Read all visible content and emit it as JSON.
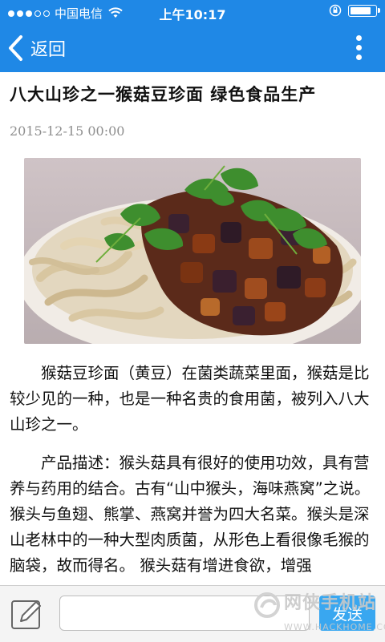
{
  "status_bar": {
    "carrier": "中国电信",
    "time": "上午10:17",
    "signal_filled": 3,
    "signal_total": 5,
    "battery_level": 0.9
  },
  "nav": {
    "back_label": "返回",
    "back_icon": "chevron-left-icon",
    "menu_icon": "more-vertical-icon"
  },
  "article": {
    "title": "八大山珍之一猴菇豆珍面 绿色食品生产",
    "date": "2015-12-15 00:00",
    "image_subject": "noodles with eggplant and cilantro",
    "paragraphs": [
      "猴菇豆珍面（黄豆）在菌类蔬菜里面，猴菇是比较少见的一种，也是一种名贵的食用菌，被列入八大山珍之一。",
      "产品描述：猴头菇具有很好的使用功效，具有营养与药用的结合。古有“山中猴头，海味燕窝”之说。猴头与鱼翅、熊掌、燕窝并誉为四大名菜。猴头是深山老林中的一种大型肉质菌，从形色上看很像毛猴的脑袋，故而得名。 猴头菇有增进食欲，增强"
    ]
  },
  "bottom_bar": {
    "compose_icon": "compose-icon",
    "input_value": "",
    "send_label": "发送"
  },
  "watermark": {
    "name": "网侠手机站",
    "url": "WWW.HACKHOME.COM"
  },
  "colors": {
    "header_blue": "#1f88e6",
    "send_blue": "#39a7f0"
  }
}
